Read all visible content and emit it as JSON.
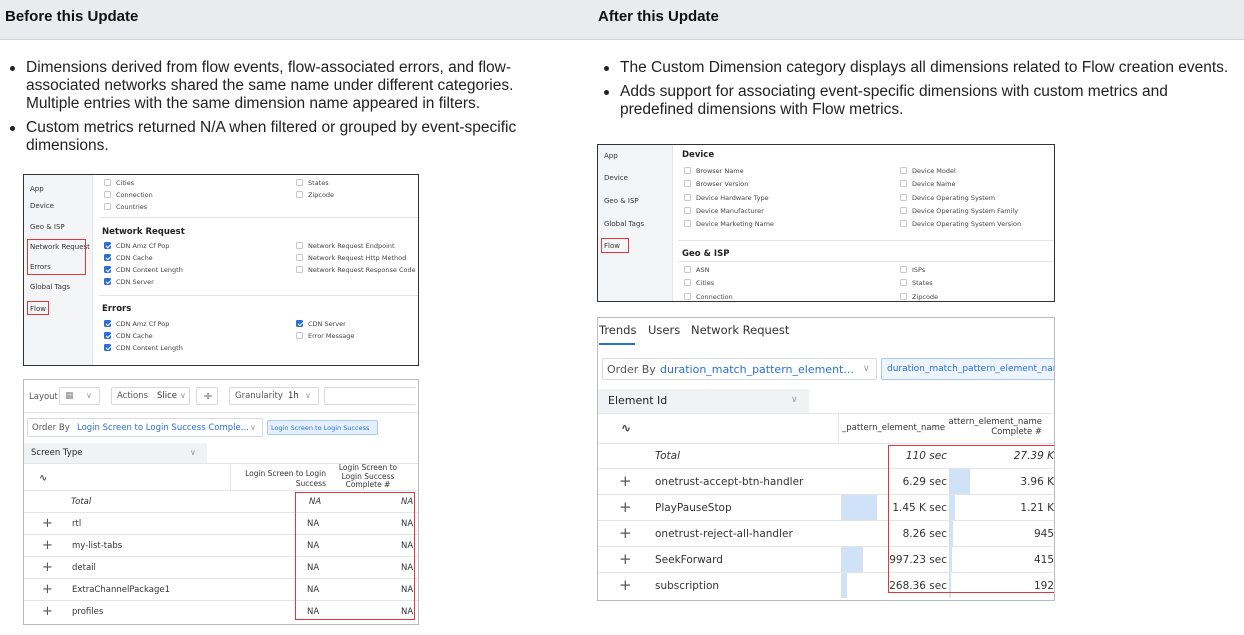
{
  "header": {
    "before": "Before this Update",
    "after": "After this Update"
  },
  "before_bullets": [
    "Dimensions derived from flow events, flow-associated errors, and flow-associated networks shared the same name under different categories. Multiple entries with the same dimension name appeared in filters.",
    "Custom metrics returned N/A when filtered or grouped by event-specific dimensions."
  ],
  "after_bullets": [
    "The Custom Dimension category displays all dimensions related to Flow creation events.",
    "Adds support for associating event-specific dimensions with custom metrics and predefined dimensions with Flow metrics."
  ],
  "before_dims": {
    "sidebar": [
      "App",
      "Device",
      "Geo & ISP",
      "Network Request",
      "Errors",
      "Global Tags",
      "Flow"
    ],
    "top_left": [
      "Cities",
      "Connection",
      "Countries"
    ],
    "top_right": [
      "States",
      "Zipcode"
    ],
    "network_title": "Network Request",
    "network_left": [
      "CDN Amz Cf Pop",
      "CDN Cache",
      "CDN Content Length",
      "CDN Server"
    ],
    "network_right": [
      "Network Request Endpoint",
      "Network Request Http Method",
      "Network Request Response Code"
    ],
    "errors_title": "Errors",
    "errors_left": [
      "CDN Amz Cf Pop",
      "CDN Cache",
      "CDN Content Length"
    ],
    "errors_right": [
      "CDN Server",
      "Error Message"
    ]
  },
  "before_table": {
    "layout_label": "Layout",
    "actions_label": "Actions",
    "slice_label": "Slice",
    "granularity_label": "Granularity",
    "granularity_value": "1h",
    "order_by_label": "Order By",
    "order_by_value": "Login Screen to Login Success Comple...",
    "chip": "Login Screen to Login Success",
    "dimension": "Screen Type",
    "col1": "Login Screen to Login Success",
    "col2": "Login Screen to Login Success Complete #",
    "total_label": "Total",
    "total_v1": "NA",
    "total_v2": "NA",
    "rows": [
      {
        "name": "rtl",
        "v1": "NA",
        "v2": "NA"
      },
      {
        "name": "my-list-tabs",
        "v1": "NA",
        "v2": "NA"
      },
      {
        "name": "detail",
        "v1": "NA",
        "v2": "NA"
      },
      {
        "name": "ExtraChannelPackage1",
        "v1": "NA",
        "v2": "NA"
      },
      {
        "name": "profiles",
        "v1": "NA",
        "v2": "NA"
      }
    ]
  },
  "after_dims": {
    "sidebar": [
      "App",
      "Device",
      "Geo & ISP",
      "Global Tags",
      "Flow"
    ],
    "device_title": "Device",
    "device_left": [
      "Browser Name",
      "Browser Version",
      "Device Hardware Type",
      "Device Manufacturer",
      "Device Marketing Name"
    ],
    "device_right": [
      "Device Model",
      "Device Name",
      "Device Operating System",
      "Device Operating System Family",
      "Device Operating System Version"
    ],
    "geo_title": "Geo & ISP",
    "geo_left": [
      "ASN",
      "Cities",
      "Connection"
    ],
    "geo_right": [
      "ISPs",
      "States",
      "Zipcode"
    ]
  },
  "after_table": {
    "tabs": [
      "Trends",
      "Users",
      "Network Request"
    ],
    "order_by_label": "Order By",
    "order_by_value": "duration_match_pattern_element...",
    "chip": "duration_match_pattern_element_name",
    "dimension": "Element Id",
    "col1": "_pattern_element_name",
    "col2": "attern_element_name Complete #",
    "total_label": "Total",
    "total_v1": "110 sec",
    "total_v2": "27.39 K",
    "rows": [
      {
        "name": "onetrust-accept-btn-handler",
        "v1": "6.29 sec",
        "v2": "3.96 K",
        "b1": 0.0,
        "b2": 0.14
      },
      {
        "name": "PlayPauseStop",
        "v1": "1.45 K sec",
        "v2": "1.21 K",
        "b1": 0.9,
        "b2": 0.04
      },
      {
        "name": "onetrust-reject-all-handler",
        "v1": "8.26 sec",
        "v2": "945",
        "b1": 0.0,
        "b2": 0.03
      },
      {
        "name": "SeekForward",
        "v1": "997.23 sec",
        "v2": "415",
        "b1": 0.55,
        "b2": 0.02
      },
      {
        "name": "subscription",
        "v1": "268.36 sec",
        "v2": "192",
        "b1": 0.15,
        "b2": 0.01
      }
    ]
  },
  "colors": {
    "accent": "#2a6fd8",
    "highlight": "#e0363f",
    "bar": "#cfe2f8"
  }
}
